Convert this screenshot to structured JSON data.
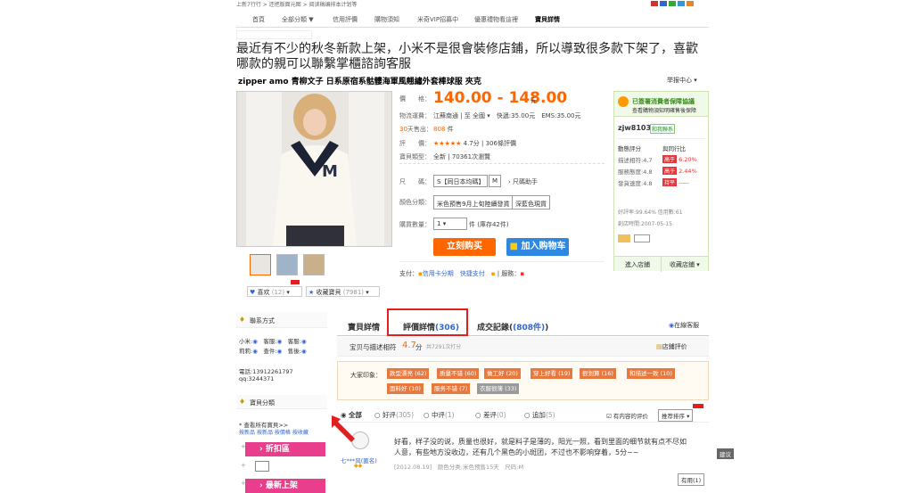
{
  "breadcrumb": "上新7行行 > 还把版面元图 > 阅读稿编排本计划等",
  "nav": [
    "首頁",
    "全部分類 ▼",
    "信用評價",
    "購物須知",
    "米奇VIP招募中",
    "優惠禮物看這裡",
    "寶貝詳情"
  ],
  "banner": "最近有不少的秋冬新款上架，小米不是很會裝修店鋪，所以導致很多款下架了，喜歡哪款的親可以聯繫掌櫃諮詢客服",
  "product_title": "zipper amo 青柳文子 日系原宿系骷髏海軍風翹繡外套棒球服 夾克",
  "report_label": "举报中心",
  "price": {
    "label": "價　　格：",
    "value": "140.00 - 148.00",
    "unit": "元"
  },
  "shipping": {
    "label": "物流運費：",
    "from": "江蘇南通",
    "to": "全國",
    "express": "快遞:35.00元",
    "ems": "EMS:35.00元"
  },
  "sold": {
    "label": "天售出：",
    "prefix": "30",
    "value": "808",
    "unit": "件"
  },
  "rating": {
    "label": "評　　價：",
    "stars": "★★★★★",
    "score": "4.7分",
    "count": "306條評價"
  },
  "condition": {
    "label": "寶貝類型：",
    "value": "全新",
    "views": "70361次瀏覽"
  },
  "size": {
    "label": "尺　　碼：",
    "opt1": "S【同日本均碼】",
    "opt2": "M",
    "helper": "尺碼助手"
  },
  "color": {
    "label": "顏色分類：",
    "opt1": "米色預售9月上旬陸續發貨",
    "opt2": "深藍色現貨"
  },
  "qty": {
    "label": "購買數量：",
    "value": "1",
    "stock": "件 (庫存42件)"
  },
  "buy_now": "立刻购买",
  "add_cart": "加入购物车",
  "pay_label": "支付：",
  "pay_opts": "信用卡分期　快捷支付",
  "service_label": "服務：",
  "like": {
    "label": "喜欢",
    "count": "(12)"
  },
  "fav": {
    "label": "收藏寶貝",
    "count": "(7981)"
  },
  "seller": {
    "protect1": "已簽署消費者保障協議",
    "protect2": "查看購物須知明確售後保障",
    "name": "zjw8103",
    "badge": "和我聯系",
    "metric_h1": "動態評分",
    "metric_h2": "與同行比",
    "m1": "描述相符:4.7",
    "m1v": "6.20%",
    "m2": "服務態度:4.8",
    "m2v": "2.44%",
    "m3": "發貨速度:4.8",
    "m3v": "-----",
    "tag_hi": "高于",
    "tag_eq": "持平",
    "good_rate": "好評率:99.64% 信用數:61",
    "created": "創店時間:2007-05-15",
    "enter": "進入店鋪",
    "fav_shop": "收藏店鋪"
  },
  "sidebar": {
    "contact": "聯系方式",
    "row1": [
      "小米:",
      "客服:",
      "客服:"
    ],
    "row2": [
      "莉莉:",
      "查件:",
      "售後:"
    ],
    "phone": "電話:13912261797",
    "qq": "qq:3244371",
    "category": "寶貝分類",
    "all_items": "* 查看所有寶貝>>",
    "sort": [
      "按新品",
      "按新品",
      "按價格",
      "按收藏"
    ],
    "cat1": "折扣區",
    "cat2": "最新上架"
  },
  "tabs": {
    "detail": "寶貝詳情",
    "reviews": "評價詳情",
    "reviews_count": "(306)",
    "deals": "成交記錄",
    "deals_count": "(808件)",
    "online": "在線客服"
  },
  "review_summary": {
    "label": "宝贝与描述相符",
    "score": "4.7",
    "unit": "分",
    "total": "共7291次打分",
    "shop_rating": "店鋪評价"
  },
  "impressions": {
    "label": "大家印象：",
    "tags": [
      "款型漂亮 (62)",
      "质量不错 (60)",
      "做工好 (20)",
      "穿上好看 (19)",
      "很划算 (16)",
      "和描述一致 (10)",
      "面料好 (10)",
      "服务不错 (7)",
      "衣服很薄 (33)"
    ]
  },
  "filters": {
    "all": "全部",
    "good": "好评",
    "good_n": "(305)",
    "mid": "中评",
    "mid_n": "(1)",
    "bad": "差评",
    "bad_n": "(0)",
    "add": "追加",
    "add_n": "(5)",
    "has_content": "有内容的评价",
    "sort": "推荐排序"
  },
  "review": {
    "user": "七***风(匿名)",
    "text": "好看，样子没的说，质量也很好，就是料子是薄的，阳光一照，看到里面的细节就有点不尽如人意，有些地方没收边，还有几个黑色的小斑团，不过也不影响穿着，5分~~",
    "date": "[2012.08.19]",
    "meta": "颜色分类:米色预售15天　尺码:M",
    "helpful": "有用(1)"
  },
  "feedback": "建议",
  "colors": {
    "accent": "#ff6600",
    "pink": "#e83e8c",
    "red": "#e02020",
    "tag_orange": "#e8793e",
    "tag_grey": "#9a9a9a"
  }
}
